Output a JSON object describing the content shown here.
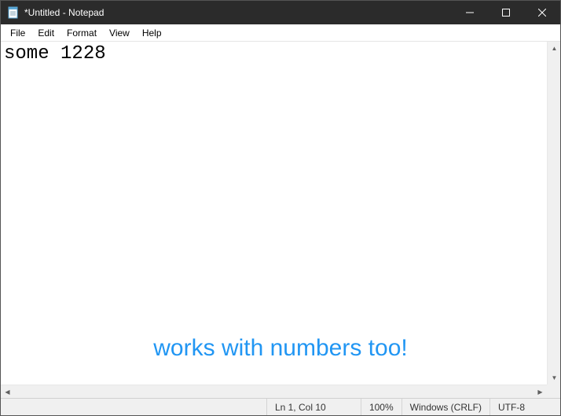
{
  "window": {
    "title": "*Untitled - Notepad"
  },
  "menu": {
    "file": "File",
    "edit": "Edit",
    "format": "Format",
    "view": "View",
    "help": "Help"
  },
  "editor": {
    "content": "some 1228"
  },
  "status": {
    "position": "Ln 1, Col 10",
    "zoom": "100%",
    "line_ending": "Windows (CRLF)",
    "encoding": "UTF-8"
  },
  "overlay": {
    "caption": "works with numbers too!"
  }
}
